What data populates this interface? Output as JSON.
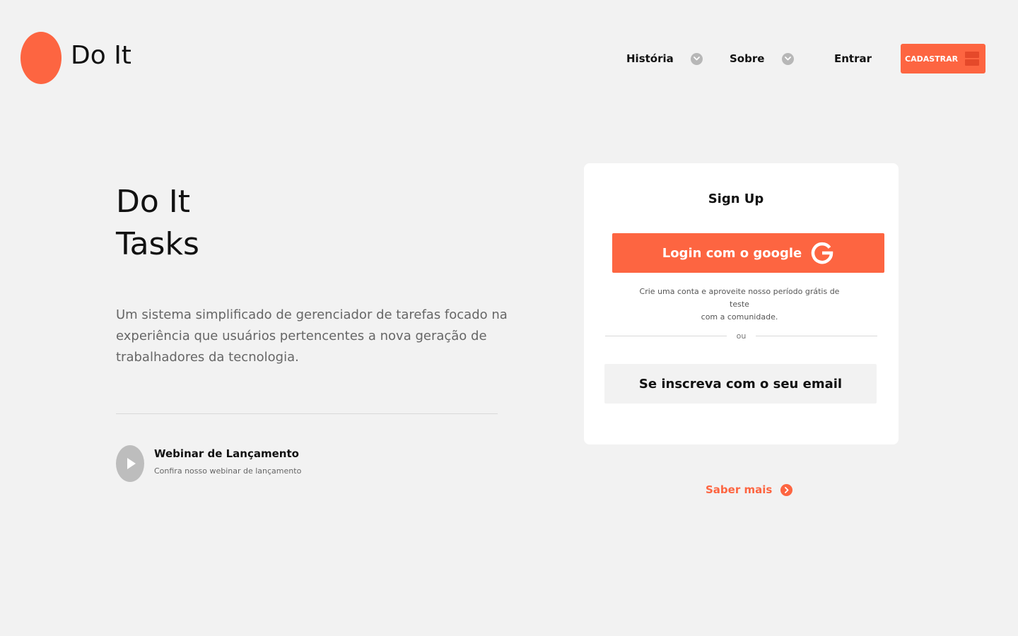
{
  "header": {
    "logo_text": "Do It",
    "nav": {
      "historia_label": "História",
      "sobre_label": "Sobre",
      "entrar_label": "Entrar"
    },
    "cadastrar_label": "CADASTRAR"
  },
  "hero": {
    "title_line1": "Do It",
    "title_line2": "Tasks",
    "description": "Um sistema simplificado de gerenciador de tarefas focado na experiência que usuários pertencentes a nova geração de trabalhadores da tecnologia.",
    "webinar": {
      "title": "Webinar de Lançamento",
      "subtitle": "Confira nosso webinar de lançamento"
    }
  },
  "signup_card": {
    "title": "Sign Up",
    "google_button_label": "Login com o google",
    "note_line1": "Crie uma conta e aproveite nosso período grátis de teste",
    "note_line2": "com a comunidade.",
    "divider_text": "ou",
    "email_button_label": "Se inscreva com o seu email"
  },
  "saber_mais_label": "Saber mais",
  "icons": {
    "logo": "orange-circle-logo",
    "chevron": "chevron-down-icon",
    "cadastrar": "stack-icon",
    "google": "google-icon",
    "play": "play-icon",
    "arrow": "chevron-right-icon"
  },
  "colors": {
    "accent": "#fd6541",
    "background": "#f2f2f2",
    "card": "#ffffff",
    "muted_icon": "#b7b7b7",
    "text": "#111111",
    "muted_text": "#666666"
  }
}
